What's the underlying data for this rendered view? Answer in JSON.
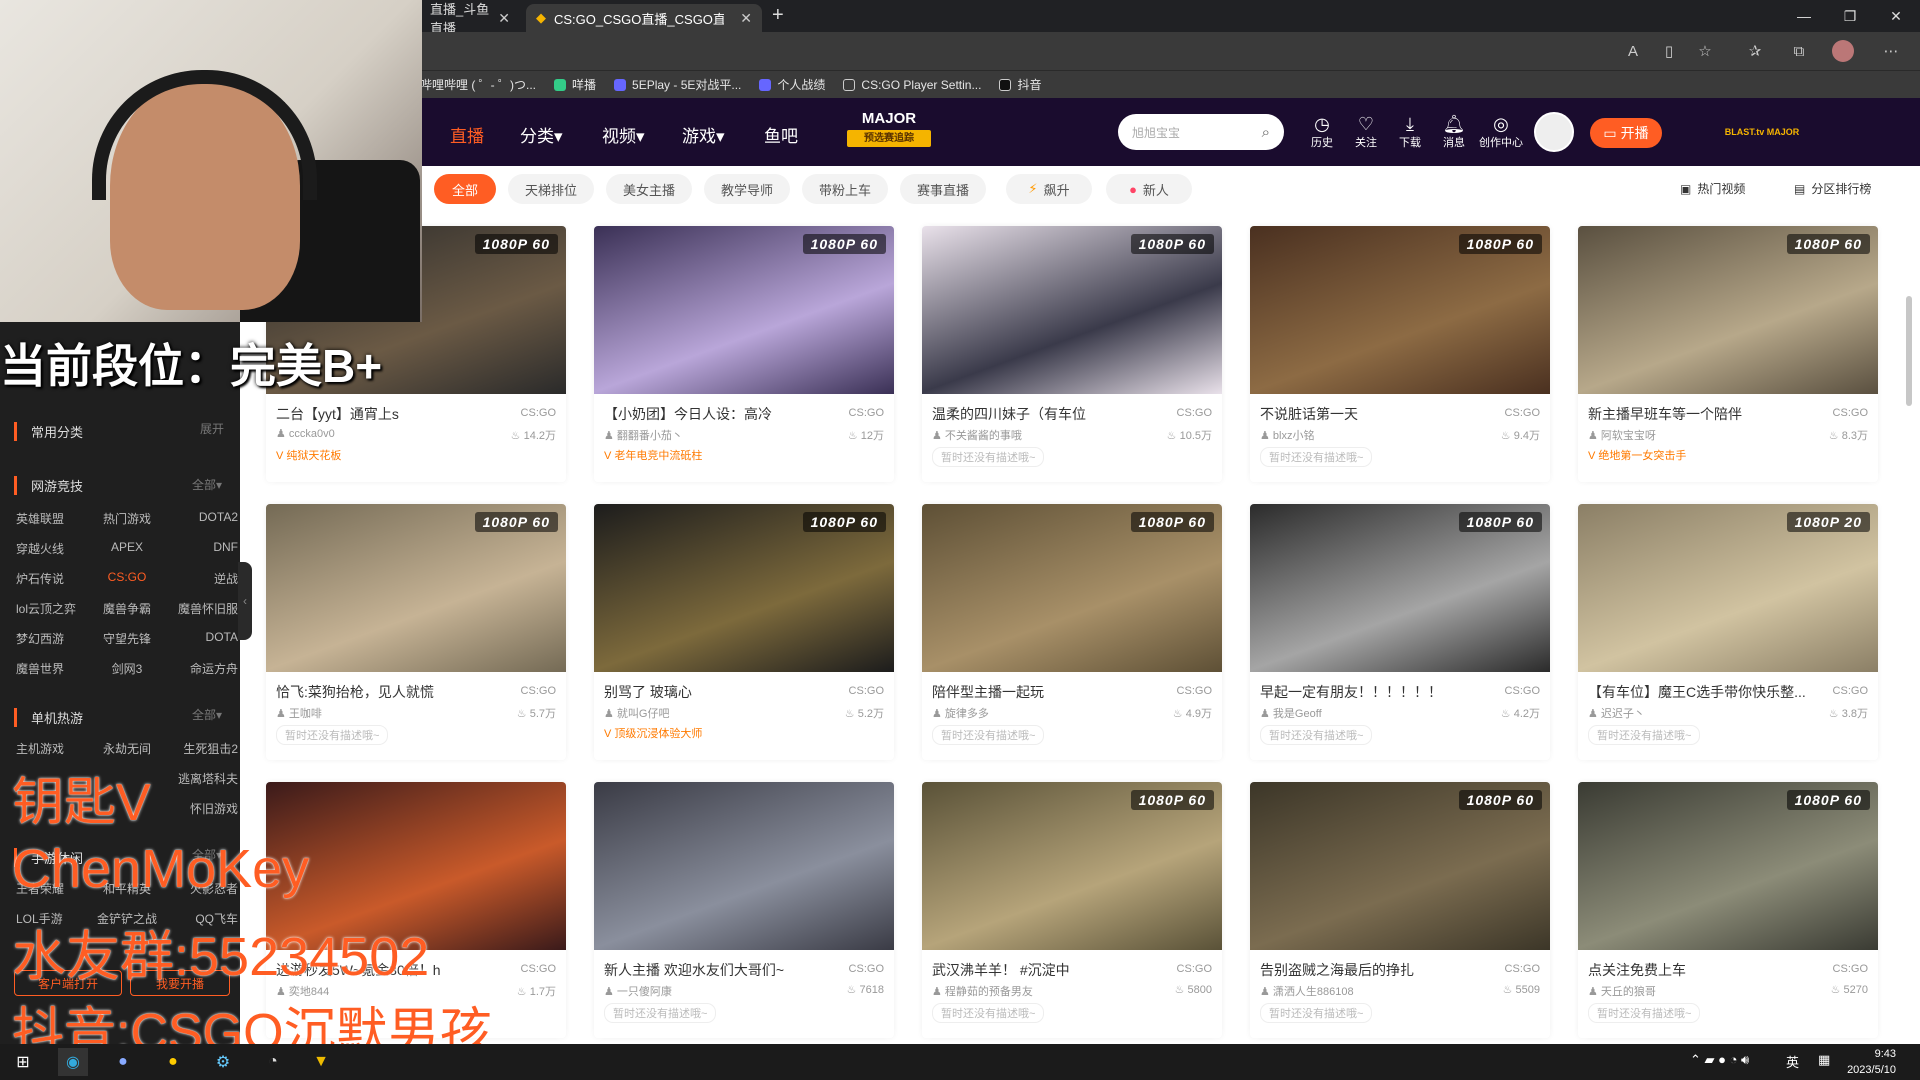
{
  "browser": {
    "tabs": [
      {
        "label": "直播_斗鱼直播"
      },
      {
        "label": "CS:GO_CSGO直播_CSGO直播视"
      }
    ],
    "bookmarks": [
      "哔哩哔哩 ( ゜- ゜)つ...",
      "咩播",
      "5EPlay - 5E对战平...",
      "个人战绩",
      "CS:GO Player Settin...",
      "抖音"
    ]
  },
  "header": {
    "nav": [
      {
        "label": "直播"
      },
      {
        "label": "分类▾"
      },
      {
        "label": "视频▾"
      },
      {
        "label": "游戏▾"
      },
      {
        "label": "鱼吧"
      }
    ],
    "major": {
      "title": "MAJOR",
      "sub": "预选赛追踪"
    },
    "search_placeholder": "旭旭宝宝",
    "icons": [
      {
        "label": "历史",
        "icon": "clock-icon"
      },
      {
        "label": "关注",
        "icon": "heart-icon"
      },
      {
        "label": "下载",
        "icon": "download-icon"
      },
      {
        "label": "消息",
        "icon": "bell-icon"
      },
      {
        "label": "创作中心",
        "icon": "bulb-icon"
      }
    ],
    "live_button": "开播",
    "blast": "BLAST.tv MAJOR"
  },
  "filters": {
    "chips": [
      "全部",
      "天梯排位",
      "美女主播",
      "教学导师",
      "带粉上车",
      "赛事直播",
      "飙升",
      "新人"
    ],
    "links": [
      "热门视频",
      "分区排行榜"
    ]
  },
  "sidebar": {
    "sections": [
      {
        "title": "常用分类",
        "more": "展开",
        "items": []
      },
      {
        "title": "网游竞技",
        "more": "全部▾",
        "items": [
          "英雄联盟",
          "热门游戏",
          "DOTA2",
          "穿越火线",
          "APEX",
          "DNF",
          "炉石传说",
          "CS:GO",
          "逆战",
          "lol云顶之弈",
          "魔兽争霸",
          "魔兽怀旧服",
          "梦幻西游",
          "守望先锋",
          "DOTA",
          "魔兽世界",
          "剑网3",
          "命运方舟"
        ]
      },
      {
        "title": "单机热游",
        "more": "全部▾",
        "items": [
          "主机游戏",
          "永劫无间",
          "生死狙击2",
          "",
          "",
          "逃离塔科夫",
          "",
          "",
          "怀旧游戏"
        ]
      },
      {
        "title": "手游休闲",
        "more": "全部▾",
        "items": [
          "王者荣耀",
          "和平精英",
          "火影忍者",
          "LOL手游",
          "金铲铲之战",
          "QQ飞车"
        ]
      }
    ],
    "bottom": [
      "客户端打开",
      "我要开播"
    ]
  },
  "cards": [
    {
      "title": "二台【yyt】通宵上s",
      "cat": "CS:GO",
      "user": "cccka0v0",
      "hot": "14.2万",
      "tag": "纯狱天花板",
      "tagtype": "gold",
      "badge": "1080P 60"
    },
    {
      "title": "【小奶团】今日人设：高冷",
      "cat": "CS:GO",
      "user": "翻翻番小茄丶",
      "hot": "12万",
      "tag": "老年电竞中流砥柱",
      "tagtype": "gold",
      "badge": "1080P 60"
    },
    {
      "title": "温柔的四川妹子（有车位",
      "cat": "CS:GO",
      "user": "不关酱酱的事哦",
      "hot": "10.5万",
      "tag": "暂时还没有描述哦~",
      "tagtype": "grey",
      "badge": "1080P 60"
    },
    {
      "title": "不说脏话第一天",
      "cat": "CS:GO",
      "user": "blxz小铭",
      "hot": "9.4万",
      "tag": "暂时还没有描述哦~",
      "tagtype": "grey",
      "badge": "1080P 60"
    },
    {
      "title": "新主播早班车等一个陪伴",
      "cat": "CS:GO",
      "user": "阿软宝宝呀",
      "hot": "8.3万",
      "tag": "绝地第一女突击手",
      "tagtype": "gold",
      "badge": "1080P 60"
    },
    {
      "title": "恰飞:菜狗抬枪，见人就慌",
      "cat": "CS:GO",
      "user": "王咖啡",
      "hot": "5.7万",
      "tag": "暂时还没有描述哦~",
      "tagtype": "grey",
      "badge": "1080P 60"
    },
    {
      "title": "别骂了 玻璃心",
      "cat": "CS:GO",
      "user": "就叫G仔吧",
      "hot": "5.2万",
      "tag": "顶级沉浸体验大师",
      "tagtype": "gold",
      "badge": "1080P 60"
    },
    {
      "title": "陪伴型主播一起玩",
      "cat": "CS:GO",
      "user": "旋律多多",
      "hot": "4.9万",
      "tag": "暂时还没有描述哦~",
      "tagtype": "grey",
      "badge": "1080P 60"
    },
    {
      "title": "早起一定有朋友！！！！！！",
      "cat": "CS:GO",
      "user": "我是Geoff",
      "hot": "4.2万",
      "tag": "暂时还没有描述哦~",
      "tagtype": "grey",
      "badge": "1080P 60"
    },
    {
      "title": "【有车位】魔王C选手带你快乐整...",
      "cat": "CS:GO",
      "user": "迟迟子丶",
      "hot": "3.8万",
      "tag": "暂时还没有描述哦~",
      "tagtype": "grey",
      "badge": "1080P 20"
    },
    {
      "title": "进游秒发5W~氪金30倍！h",
      "cat": "CS:GO",
      "user": "奕地844",
      "hot": "1.7万",
      "tag": "",
      "tagtype": "grey",
      "badge": ""
    },
    {
      "title": "新人主播 欢迎水友们大哥们~",
      "cat": "CS:GO",
      "user": "一只傻阿康",
      "hot": "7618",
      "tag": "暂时还没有描述哦~",
      "tagtype": "grey",
      "badge": ""
    },
    {
      "title": "武汉沸羊羊！ #沉淀中",
      "cat": "CS:GO",
      "user": "程静茹的预备男友",
      "hot": "5800",
      "tag": "暂时还没有描述哦~",
      "tagtype": "grey",
      "badge": "1080P 60"
    },
    {
      "title": "告别盗贼之海最后的挣扎",
      "cat": "CS:GO",
      "user": "潇洒人生886108",
      "hot": "5509",
      "tag": "暂时还没有描述哦~",
      "tagtype": "grey",
      "badge": "1080P 60"
    },
    {
      "title": "点关注免费上车",
      "cat": "CS:GO",
      "user": "天丘的狼哥",
      "hot": "5270",
      "tag": "暂时还没有描述哦~",
      "tagtype": "grey",
      "badge": "1080P 60"
    }
  ],
  "overlay": {
    "rank": "当前段位：完美B+",
    "key": "钥匙V",
    "name": "ChenMoKey",
    "group": "水友群:55234502",
    "douyin": "抖音:CSGO沉默男孩"
  },
  "taskbar": {
    "time": "9:43",
    "date": "2023/5/10",
    "ime": "英"
  }
}
